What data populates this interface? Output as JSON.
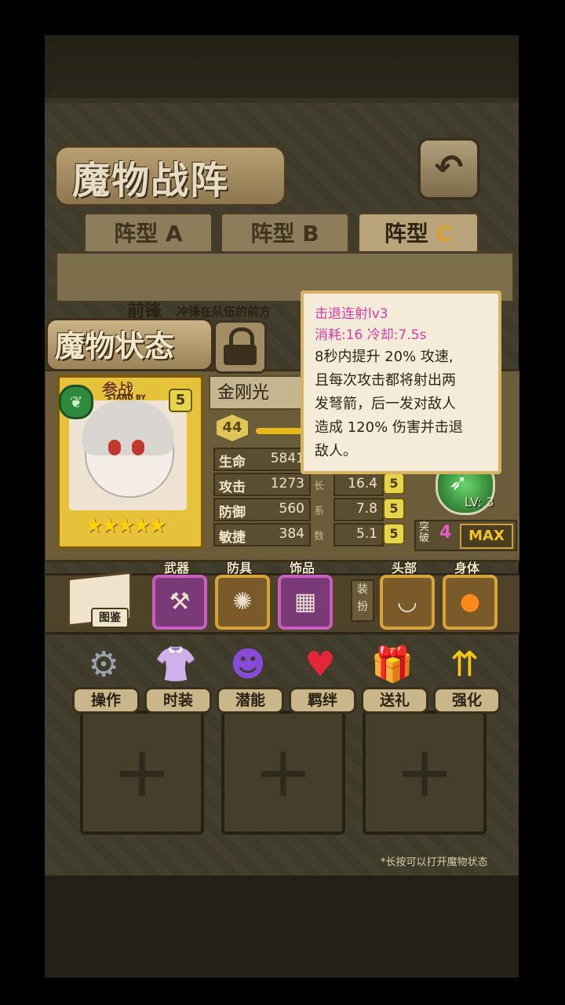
{
  "header": {
    "title": "魔物战阵",
    "back_icon": "return-arrow-icon"
  },
  "tabs": [
    {
      "label": "阵型",
      "letter": "A",
      "active": false
    },
    {
      "label": "阵型",
      "letter": "B",
      "active": false
    },
    {
      "label": "阵型",
      "letter": "C",
      "active": true
    }
  ],
  "formation": {
    "position": "前锋",
    "description": "冲锋在队伍的前方"
  },
  "hint": "*长按可以打开魔物状态",
  "status_panel": {
    "title": "魔物状态",
    "card": {
      "standby_cn": "参战",
      "standby_en": "STAND BY",
      "grade": "5",
      "stars": "★★★★★"
    },
    "name": "金刚光",
    "level": "44",
    "stats": [
      {
        "label": "生命",
        "value": "5841",
        "grow_label": "",
        "grow": "",
        "grade": ""
      },
      {
        "label": "攻击",
        "value": "1273",
        "grow_label": "长",
        "grow": "16.4",
        "grade": "5"
      },
      {
        "label": "防御",
        "value": "560",
        "grow_label": "系",
        "grow": "7.8",
        "grade": "5"
      },
      {
        "label": "敏捷",
        "value": "384",
        "grow_label": "数",
        "grow": "5.1",
        "grade": "5"
      }
    ],
    "skill": {
      "level": "LV: 3"
    },
    "break": {
      "label": "突破",
      "value": "4",
      "max": "MAX"
    }
  },
  "tooltip": {
    "title": "击退连射lv3",
    "cost": "消耗:16  冷却:7.5s",
    "lines": [
      "8秒内提升 20% 攻速,",
      "且每次攻击都将射出两",
      "发弩箭，后一发对敌人",
      "造成 120% 伤害并击退",
      "敌人。"
    ]
  },
  "equipment": {
    "book_label": "图鉴",
    "slots": [
      {
        "label": "武器",
        "icon": "scythe-icon"
      },
      {
        "label": "防具",
        "icon": "compass-armor-icon"
      },
      {
        "label": "饰品",
        "icon": "stone-tablet-icon"
      }
    ],
    "toggle": "装扮",
    "cosmetics": [
      {
        "label": "头部",
        "icon": "headband-icon"
      },
      {
        "label": "身体",
        "icon": "pumpkin-icon"
      }
    ]
  },
  "menu": [
    {
      "label": "操作",
      "icon": "gear-icon"
    },
    {
      "label": "时装",
      "icon": "outfit-icon"
    },
    {
      "label": "潜能",
      "icon": "demon-icon"
    },
    {
      "label": "羁绊",
      "icon": "hearts-icon"
    },
    {
      "label": "送礼",
      "icon": "gift-icon"
    },
    {
      "label": "强化",
      "icon": "upgrade-arrows-icon"
    }
  ]
}
